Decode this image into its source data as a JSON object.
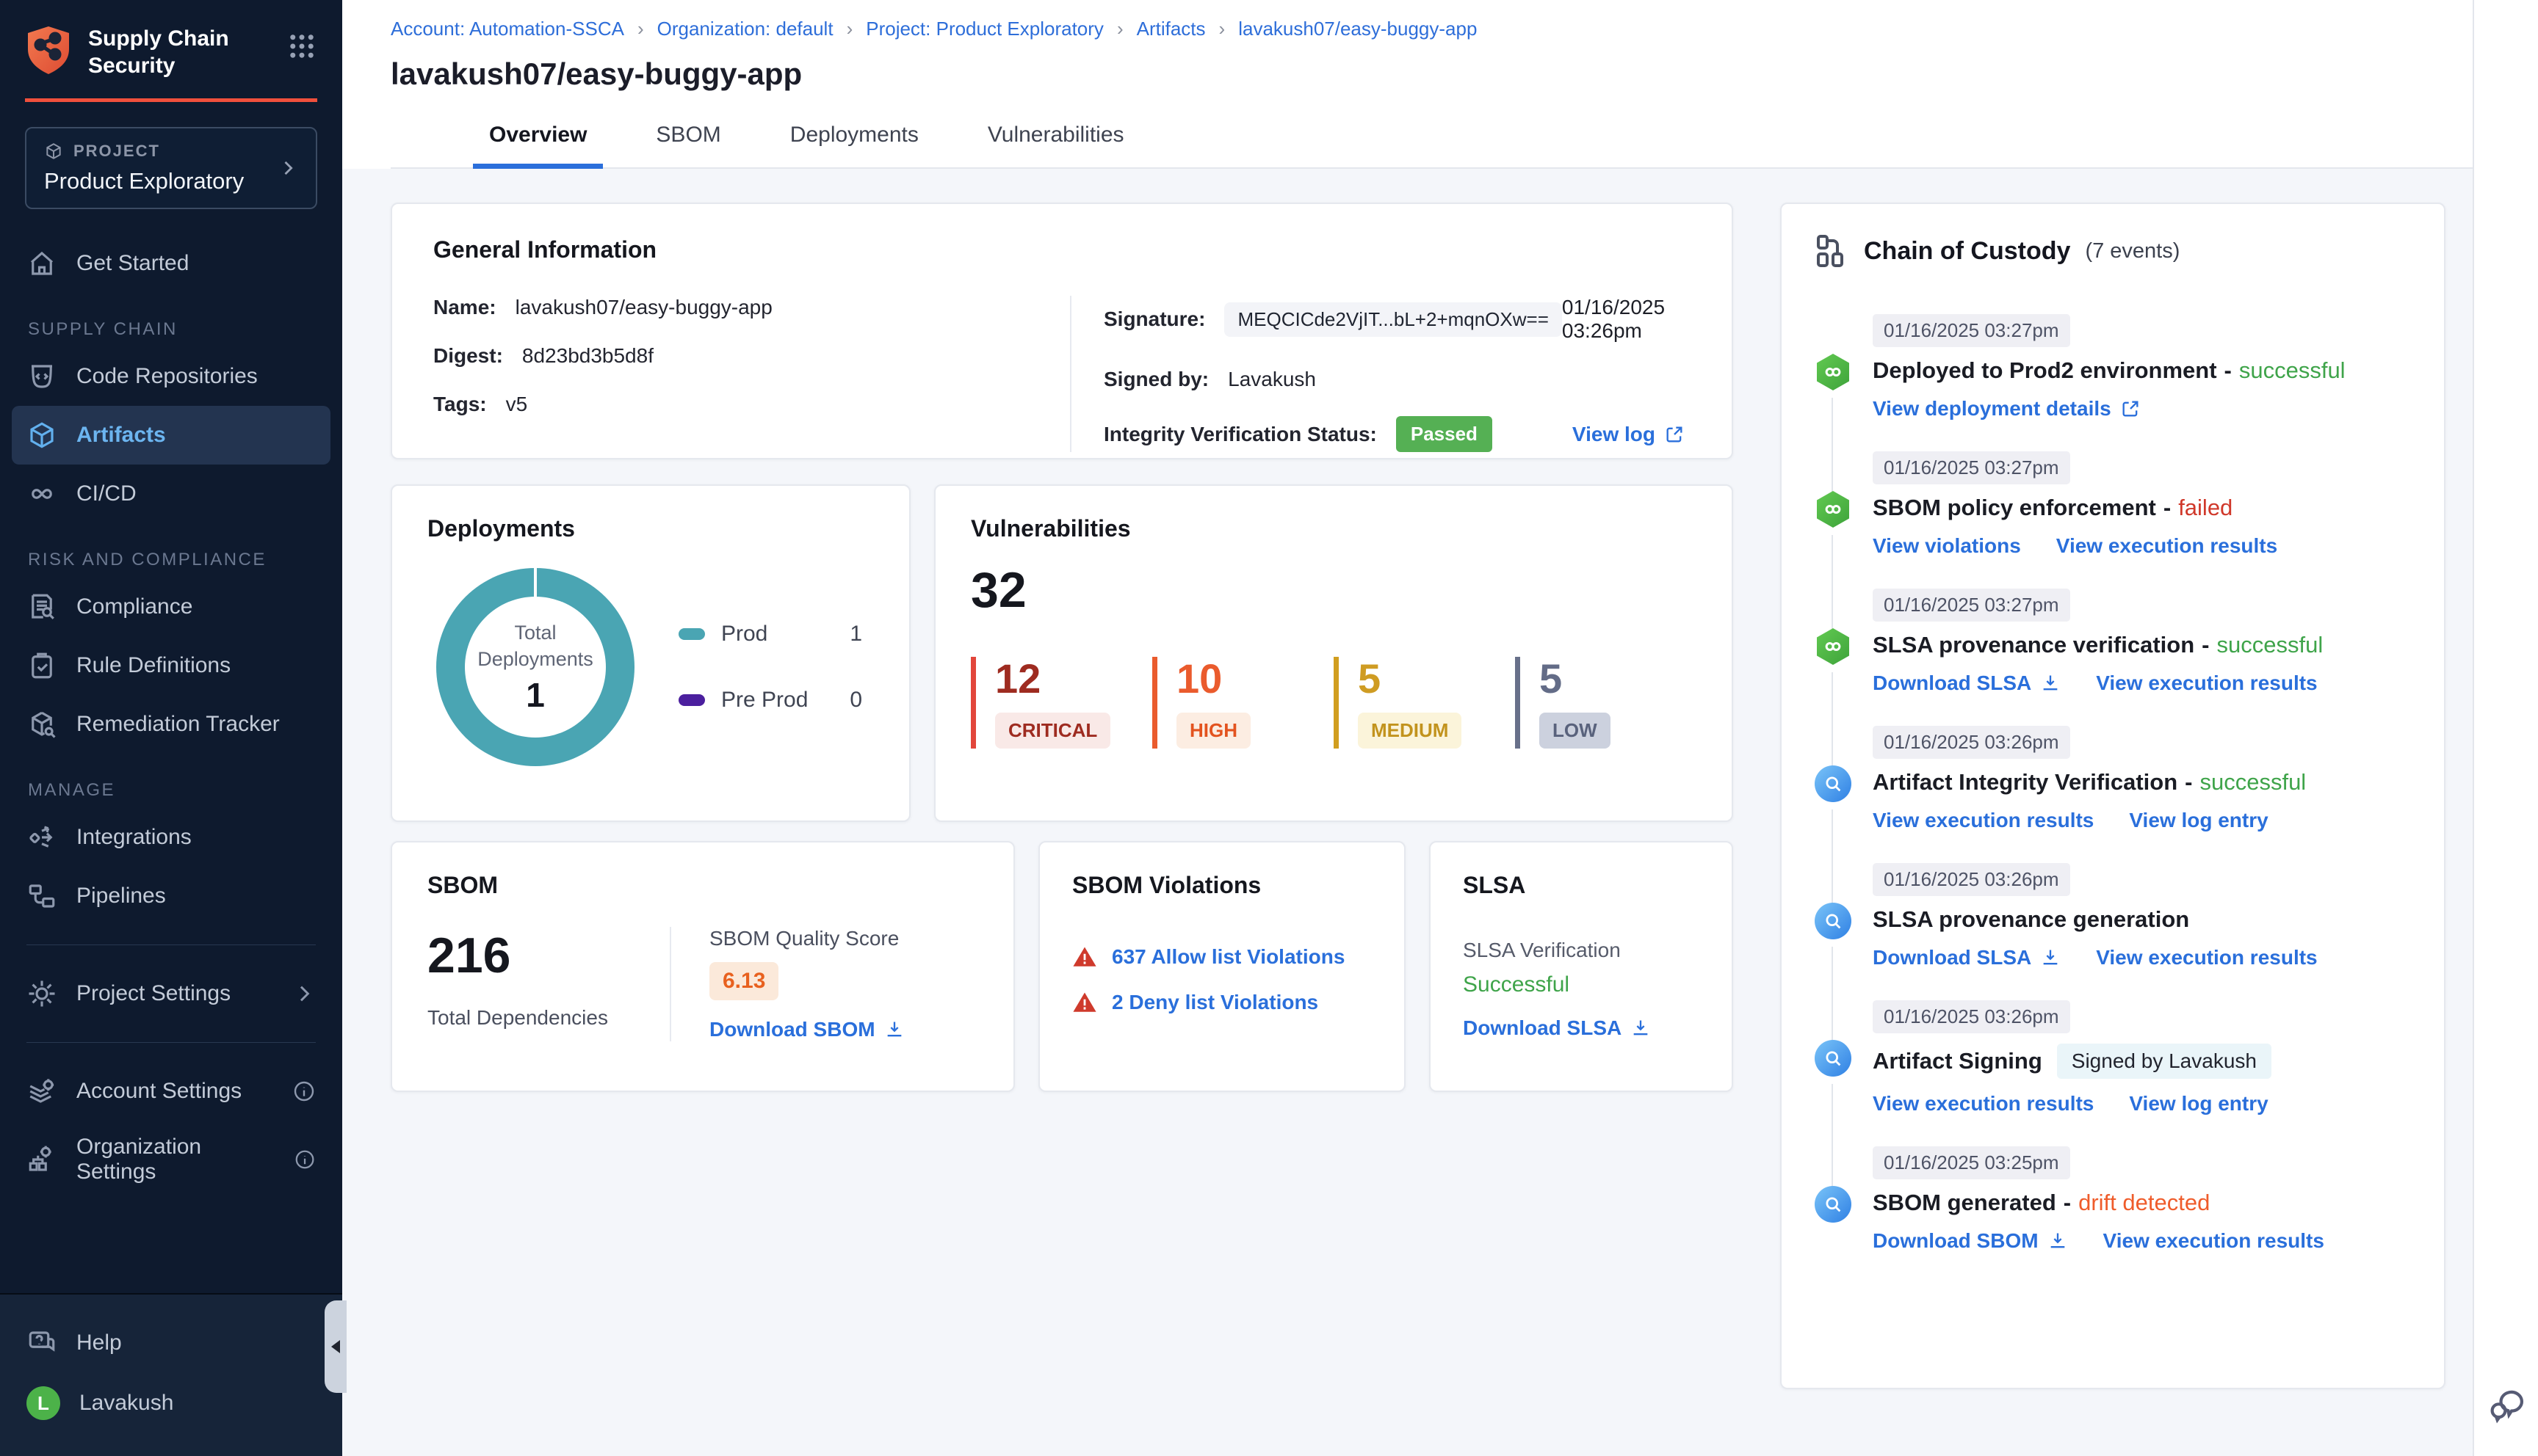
{
  "colors": {
    "accent_orange": "#f0503c",
    "link_blue": "#2a6fdb",
    "success_green": "#3fa44a",
    "failed_red": "#d0382a",
    "drift_orange": "#ef5c2b",
    "donut_teal": "#4aa5b3",
    "preprod_purple": "#4b1f9e",
    "passed_badge_green": "#55b054"
  },
  "sidebar": {
    "app_title_line1": "Supply Chain",
    "app_title_line2": "Security",
    "project_label": "PROJECT",
    "project_name": "Product Exploratory",
    "get_started": "Get Started",
    "sections": [
      {
        "header": "SUPPLY CHAIN",
        "items": [
          {
            "label": "Code Repositories"
          },
          {
            "label": "Artifacts"
          },
          {
            "label": "CI/CD"
          }
        ]
      },
      {
        "header": "RISK AND COMPLIANCE",
        "items": [
          {
            "label": "Compliance"
          },
          {
            "label": "Rule Definitions"
          },
          {
            "label": "Remediation Tracker"
          }
        ]
      },
      {
        "header": "MANAGE",
        "items": [
          {
            "label": "Integrations"
          },
          {
            "label": "Pipelines"
          }
        ]
      }
    ],
    "project_settings": "Project Settings",
    "account_settings": "Account Settings",
    "organization_settings": "Organization Settings",
    "help": "Help",
    "user_name": "Lavakush",
    "user_initial": "L"
  },
  "breadcrumb": [
    "Account: Automation-SSCA",
    "Organization: default",
    "Project: Product Exploratory",
    "Artifacts",
    "lavakush07/easy-buggy-app"
  ],
  "page_title": "lavakush07/easy-buggy-app",
  "tabs": [
    {
      "label": "Overview"
    },
    {
      "label": "SBOM"
    },
    {
      "label": "Deployments"
    },
    {
      "label": "Vulnerabilities"
    }
  ],
  "general_info": {
    "title": "General Information",
    "name_label": "Name:",
    "name": "lavakush07/easy-buggy-app",
    "digest_label": "Digest:",
    "digest": "8d23bd3b5d8f",
    "tags_label": "Tags:",
    "tags": "v5",
    "signature_label": "Signature:",
    "signature": "MEQCICde2VjIT...bL+2+mqnOXw==",
    "signature_date": "01/16/2025 03:26pm",
    "signed_by_label": "Signed by:",
    "signed_by": "Lavakush",
    "integrity_label": "Integrity Verification Status:",
    "integrity_status": "Passed",
    "view_log": "View log"
  },
  "deployments": {
    "title": "Deployments",
    "center_label1": "Total",
    "center_label2": "Deployments",
    "total": "1",
    "legend": [
      {
        "label": "Prod",
        "value": "1"
      },
      {
        "label": "Pre Prod",
        "value": "0"
      }
    ]
  },
  "chart_data": {
    "type": "pie",
    "title": "Deployments",
    "categories": [
      "Prod",
      "Pre Prod"
    ],
    "values": [
      1,
      0
    ],
    "center_label": "Total Deployments",
    "total": 1
  },
  "vulnerabilities": {
    "title": "Vulnerabilities",
    "total": "32",
    "severities": [
      {
        "label": "CRITICAL",
        "count": "12"
      },
      {
        "label": "HIGH",
        "count": "10"
      },
      {
        "label": "MEDIUM",
        "count": "5"
      },
      {
        "label": "LOW",
        "count": "5"
      }
    ]
  },
  "sbom": {
    "title": "SBOM",
    "total": "216",
    "total_label": "Total Dependencies",
    "quality_label": "SBOM Quality Score",
    "quality_score": "6.13",
    "download": "Download SBOM"
  },
  "sbom_violations": {
    "title": "SBOM Violations",
    "items": [
      {
        "label": "637 Allow list Violations"
      },
      {
        "label": "2 Deny list Violations"
      }
    ]
  },
  "slsa": {
    "title": "SLSA",
    "verification_label": "SLSA Verification",
    "verification_status": "Successful",
    "download": "Download SLSA"
  },
  "chain_of_custody": {
    "title": "Chain of Custody",
    "count": "(7 events)",
    "events": [
      {
        "timestamp": "01/16/2025 03:27pm",
        "title": "Deployed to Prod2 environment",
        "status": "successful",
        "links": [
          {
            "label": "View deployment details",
            "icon": "external-link"
          }
        ]
      },
      {
        "timestamp": "01/16/2025 03:27pm",
        "title": "SBOM policy enforcement",
        "status": "failed",
        "links": [
          {
            "label": "View violations"
          },
          {
            "label": "View execution results"
          }
        ]
      },
      {
        "timestamp": "01/16/2025 03:27pm",
        "title": "SLSA provenance verification",
        "status": "successful",
        "links": [
          {
            "label": "Download SLSA",
            "icon": "download"
          },
          {
            "label": "View execution results"
          }
        ]
      },
      {
        "timestamp": "01/16/2025 03:26pm",
        "title": "Artifact Integrity Verification",
        "status": "successful",
        "links": [
          {
            "label": "View execution results"
          },
          {
            "label": "View log entry"
          }
        ]
      },
      {
        "timestamp": "01/16/2025 03:26pm",
        "title": "SLSA provenance generation",
        "status": "",
        "links": [
          {
            "label": "Download SLSA",
            "icon": "download"
          },
          {
            "label": "View execution results"
          }
        ]
      },
      {
        "timestamp": "01/16/2025 03:26pm",
        "title": "Artifact Signing",
        "badge": "Signed by Lavakush",
        "links": [
          {
            "label": "View execution results"
          },
          {
            "label": "View log entry"
          }
        ]
      },
      {
        "timestamp": "01/16/2025 03:25pm",
        "title": "SBOM generated",
        "status": "drift detected",
        "links": [
          {
            "label": "Download SBOM",
            "icon": "download"
          },
          {
            "label": "View execution results"
          }
        ]
      }
    ]
  }
}
